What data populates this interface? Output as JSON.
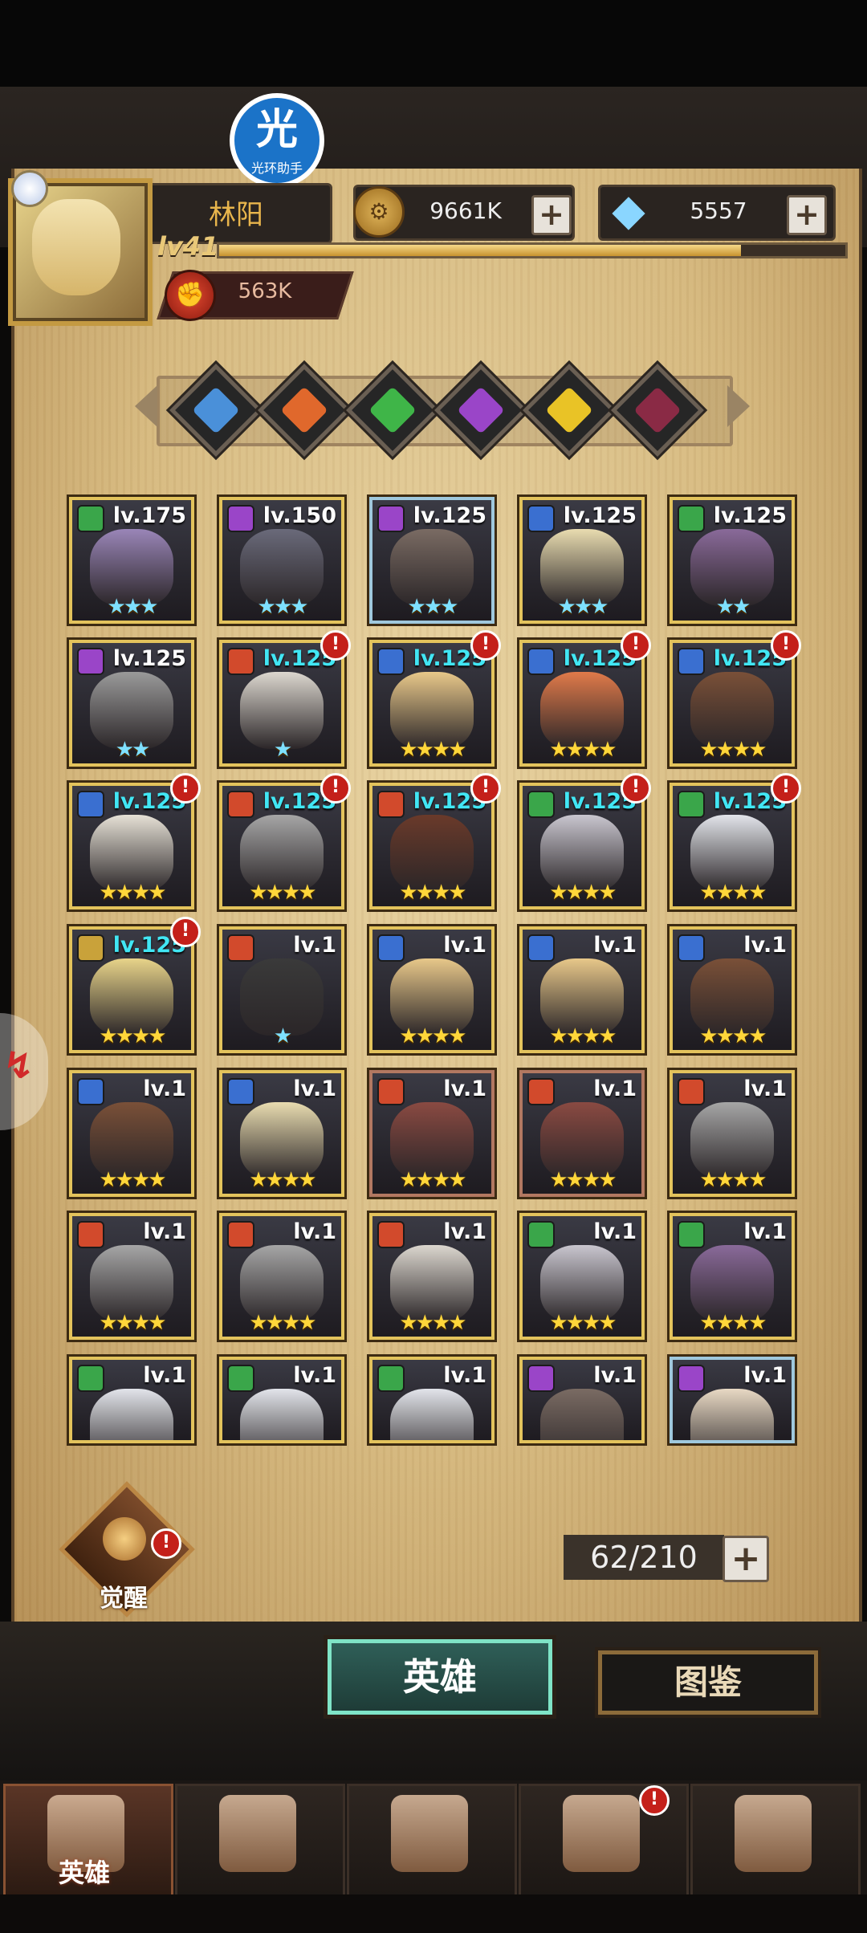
{
  "player": {
    "name": "林阳",
    "level_label": "lv41",
    "gold": "9661K",
    "gems": "5557",
    "power": "563K",
    "level_progress": 0.84
  },
  "assistant_badge": {
    "label": "光环助手"
  },
  "faction_filters": [
    {
      "name": "faction-1",
      "color": "#4a90d9"
    },
    {
      "name": "faction-2",
      "color": "#e0682c"
    },
    {
      "name": "faction-3",
      "color": "#3fb548"
    },
    {
      "name": "faction-4",
      "color": "#9a45c8"
    },
    {
      "name": "faction-5",
      "color": "#e9c326"
    },
    {
      "name": "faction-6",
      "color": "#8a2a45"
    }
  ],
  "heroes": [
    {
      "lv": "lv.175",
      "stars": 3,
      "cyan_lv": false,
      "cyan_stars": true,
      "alert": false,
      "frame": "gold",
      "class_color": "#3aa64a",
      "face": "#9a86b8"
    },
    {
      "lv": "lv.150",
      "stars": 3,
      "cyan_lv": false,
      "cyan_stars": true,
      "alert": false,
      "frame": "gold",
      "class_color": "#9a45c8",
      "face": "#6a6a7a"
    },
    {
      "lv": "lv.125",
      "stars": 3,
      "cyan_lv": false,
      "cyan_stars": true,
      "alert": false,
      "frame": "blue",
      "class_color": "#9a45c8",
      "face": "#7a6b63"
    },
    {
      "lv": "lv.125",
      "stars": 3,
      "cyan_lv": false,
      "cyan_stars": true,
      "alert": false,
      "frame": "gold",
      "class_color": "#3a6fd0",
      "face": "#e9dcb0"
    },
    {
      "lv": "lv.125",
      "stars": 2,
      "cyan_lv": false,
      "cyan_stars": true,
      "alert": false,
      "frame": "gold",
      "class_color": "#3aa64a",
      "face": "#8a6a9a"
    },
    {
      "lv": "lv.125",
      "stars": 2,
      "cyan_lv": false,
      "cyan_stars": true,
      "alert": false,
      "frame": "gold",
      "class_color": "#9a45c8",
      "face": "#9a9a9a"
    },
    {
      "lv": "lv.125",
      "stars": 1,
      "cyan_lv": true,
      "cyan_stars": true,
      "alert": true,
      "frame": "gold",
      "class_color": "#d24a2c",
      "face": "#dcd7cf"
    },
    {
      "lv": "lv.125",
      "stars": 4,
      "cyan_lv": true,
      "cyan_stars": false,
      "alert": true,
      "frame": "gold",
      "class_color": "#3a6fd0",
      "face": "#e8c88a"
    },
    {
      "lv": "lv.125",
      "stars": 4,
      "cyan_lv": true,
      "cyan_stars": false,
      "alert": true,
      "frame": "gold",
      "class_color": "#3a6fd0",
      "face": "#e07a4a"
    },
    {
      "lv": "lv.125",
      "stars": 4,
      "cyan_lv": true,
      "cyan_stars": false,
      "alert": true,
      "frame": "gold",
      "class_color": "#3a6fd0",
      "face": "#7a5038"
    },
    {
      "lv": "lv.125",
      "stars": 4,
      "cyan_lv": true,
      "cyan_stars": false,
      "alert": true,
      "frame": "gold",
      "class_color": "#3a6fd0",
      "face": "#e6e1d6"
    },
    {
      "lv": "lv.125",
      "stars": 4,
      "cyan_lv": true,
      "cyan_stars": false,
      "alert": true,
      "frame": "gold",
      "class_color": "#d24a2c",
      "face": "#a6a6a6"
    },
    {
      "lv": "lv.125",
      "stars": 4,
      "cyan_lv": true,
      "cyan_stars": false,
      "alert": true,
      "frame": "gold",
      "class_color": "#d24a2c",
      "face": "#6a3a2a"
    },
    {
      "lv": "lv.125",
      "stars": 4,
      "cyan_lv": true,
      "cyan_stars": false,
      "alert": true,
      "frame": "gold",
      "class_color": "#3aa64a",
      "face": "#c9c6cf"
    },
    {
      "lv": "lv.125",
      "stars": 4,
      "cyan_lv": true,
      "cyan_stars": false,
      "alert": true,
      "frame": "gold",
      "class_color": "#3aa64a",
      "face": "#e2e4ea"
    },
    {
      "lv": "lv.125",
      "stars": 4,
      "cyan_lv": true,
      "cyan_stars": false,
      "alert": true,
      "frame": "gold",
      "class_color": "#c9a23a",
      "face": "#e8d48a"
    },
    {
      "lv": "lv.1",
      "stars": 1,
      "cyan_lv": false,
      "cyan_stars": true,
      "alert": false,
      "frame": "gold",
      "class_color": "#d24a2c",
      "face": "#3a3a3a"
    },
    {
      "lv": "lv.1",
      "stars": 4,
      "cyan_lv": false,
      "cyan_stars": false,
      "alert": false,
      "frame": "gold",
      "class_color": "#3a6fd0",
      "face": "#e8c88a"
    },
    {
      "lv": "lv.1",
      "stars": 4,
      "cyan_lv": false,
      "cyan_stars": false,
      "alert": false,
      "frame": "gold",
      "class_color": "#3a6fd0",
      "face": "#e8c88a"
    },
    {
      "lv": "lv.1",
      "stars": 4,
      "cyan_lv": false,
      "cyan_stars": false,
      "alert": false,
      "frame": "gold",
      "class_color": "#3a6fd0",
      "face": "#7a5038"
    },
    {
      "lv": "lv.1",
      "stars": 4,
      "cyan_lv": false,
      "cyan_stars": false,
      "alert": false,
      "frame": "gold",
      "class_color": "#3a6fd0",
      "face": "#7a5038"
    },
    {
      "lv": "lv.1",
      "stars": 4,
      "cyan_lv": false,
      "cyan_stars": false,
      "alert": false,
      "frame": "gold",
      "class_color": "#3a6fd0",
      "face": "#e9dcb0"
    },
    {
      "lv": "lv.1",
      "stars": 4,
      "cyan_lv": false,
      "cyan_stars": false,
      "alert": false,
      "frame": "red",
      "class_color": "#d24a2c",
      "face": "#8a4a42"
    },
    {
      "lv": "lv.1",
      "stars": 4,
      "cyan_lv": false,
      "cyan_stars": false,
      "alert": false,
      "frame": "red",
      "class_color": "#d24a2c",
      "face": "#8a4a42"
    },
    {
      "lv": "lv.1",
      "stars": 4,
      "cyan_lv": false,
      "cyan_stars": false,
      "alert": false,
      "frame": "gold",
      "class_color": "#d24a2c",
      "face": "#a6a6a6"
    },
    {
      "lv": "lv.1",
      "stars": 4,
      "cyan_lv": false,
      "cyan_stars": false,
      "alert": false,
      "frame": "gold",
      "class_color": "#d24a2c",
      "face": "#a6a6a6"
    },
    {
      "lv": "lv.1",
      "stars": 4,
      "cyan_lv": false,
      "cyan_stars": false,
      "alert": false,
      "frame": "gold",
      "class_color": "#d24a2c",
      "face": "#a6a6a6"
    },
    {
      "lv": "lv.1",
      "stars": 4,
      "cyan_lv": false,
      "cyan_stars": false,
      "alert": false,
      "frame": "gold",
      "class_color": "#d24a2c",
      "face": "#dcd7cf"
    },
    {
      "lv": "lv.1",
      "stars": 4,
      "cyan_lv": false,
      "cyan_stars": false,
      "alert": false,
      "frame": "gold",
      "class_color": "#3aa64a",
      "face": "#c9c6cf"
    },
    {
      "lv": "lv.1",
      "stars": 4,
      "cyan_lv": false,
      "cyan_stars": false,
      "alert": false,
      "frame": "gold",
      "class_color": "#3aa64a",
      "face": "#8a6a9a"
    },
    {
      "lv": "lv.1",
      "stars": 0,
      "cyan_lv": false,
      "cyan_stars": false,
      "alert": false,
      "frame": "gold",
      "class_color": "#3aa64a",
      "face": "#e2e4ea"
    },
    {
      "lv": "lv.1",
      "stars": 0,
      "cyan_lv": false,
      "cyan_stars": false,
      "alert": false,
      "frame": "gold",
      "class_color": "#3aa64a",
      "face": "#e2e4ea"
    },
    {
      "lv": "lv.1",
      "stars": 0,
      "cyan_lv": false,
      "cyan_stars": false,
      "alert": false,
      "frame": "gold",
      "class_color": "#3aa64a",
      "face": "#e2e4ea"
    },
    {
      "lv": "lv.1",
      "stars": 0,
      "cyan_lv": false,
      "cyan_stars": false,
      "alert": false,
      "frame": "gold",
      "class_color": "#9a45c8",
      "face": "#7a6b63"
    },
    {
      "lv": "lv.1",
      "stars": 0,
      "cyan_lv": false,
      "cyan_stars": false,
      "alert": false,
      "frame": "blue",
      "class_color": "#9a45c8",
      "face": "#e8d9c4"
    }
  ],
  "awaken": {
    "label": "觉醒"
  },
  "capacity": {
    "text": "62/210"
  },
  "tabs": {
    "hero": "英雄",
    "codex": "图鉴"
  },
  "nav": {
    "active_label": "英雄",
    "items": [
      "hero",
      "adventure",
      "battle",
      "castle",
      "guild"
    ]
  },
  "plus_symbol": "+",
  "alert_symbol": "!"
}
